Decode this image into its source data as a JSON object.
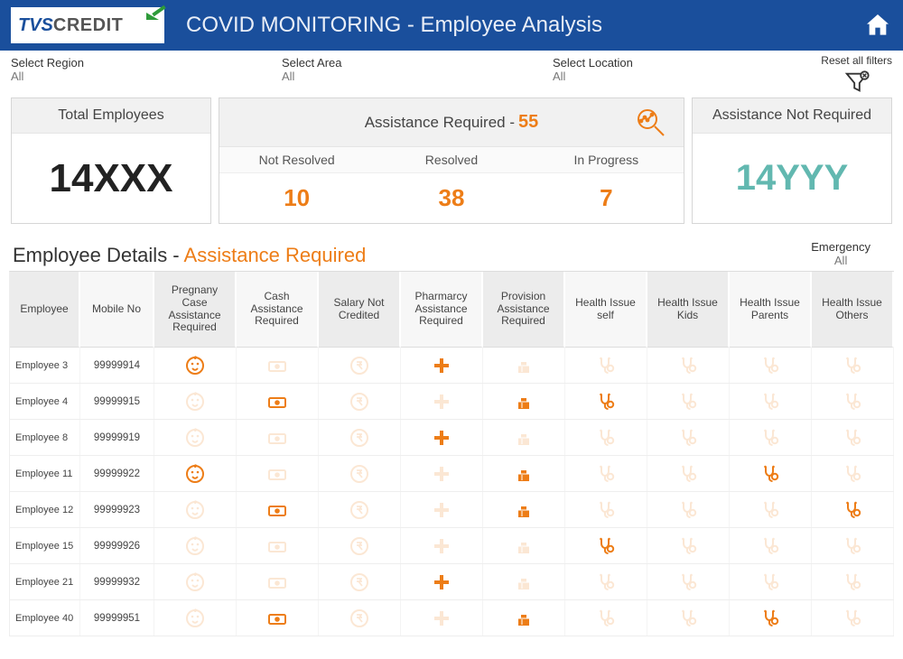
{
  "header": {
    "logo_text_1": "TVS",
    "logo_text_2": "CREDIT",
    "title": "COVID MONITORING - Employee Analysis"
  },
  "filters": {
    "region": {
      "label": "Select Region",
      "value": "All"
    },
    "area": {
      "label": "Select Area",
      "value": "All"
    },
    "location": {
      "label": "Select Location",
      "value": "All"
    },
    "reset_label": "Reset all filters"
  },
  "cards": {
    "total": {
      "title": "Total Employees",
      "value": "14XXX"
    },
    "assist": {
      "title": "Assistance Required -",
      "count": "55",
      "cols": [
        {
          "label": "Not Resolved",
          "value": "10"
        },
        {
          "label": "Resolved",
          "value": "38"
        },
        {
          "label": "In Progress",
          "value": "7"
        }
      ]
    },
    "notreq": {
      "title": "Assistance Not Required",
      "value": "14YYY"
    }
  },
  "details": {
    "title_a": "Employee Details - ",
    "title_b": "Assistance Required",
    "emergency": {
      "label": "Emergency",
      "value": "All"
    }
  },
  "table": {
    "headers": [
      "Employee",
      "Mobile No",
      "Pregnany Case Assistance Required",
      "Cash Assistance Required",
      "Salary Not Credited",
      "Pharmarcy Assistance Required",
      "Provision Assistance Required",
      "Health Issue self",
      "Health Issue Kids",
      "Health Issue Parents",
      "Health Issue Others"
    ],
    "rows": [
      {
        "emp": "Employee 3",
        "mobile": "99999914",
        "flags": [
          1,
          0,
          0,
          1,
          0,
          0,
          0,
          0,
          0
        ]
      },
      {
        "emp": "Employee 4",
        "mobile": "99999915",
        "flags": [
          0,
          1,
          0,
          0,
          1,
          1,
          0,
          0,
          0
        ]
      },
      {
        "emp": "Employee 8",
        "mobile": "99999919",
        "flags": [
          0,
          0,
          0,
          1,
          0,
          0,
          0,
          0,
          0
        ]
      },
      {
        "emp": "Employee 11",
        "mobile": "99999922",
        "flags": [
          1,
          0,
          0,
          0,
          1,
          0,
          0,
          1,
          0
        ]
      },
      {
        "emp": "Employee 12",
        "mobile": "99999923",
        "flags": [
          0,
          1,
          0,
          0,
          1,
          0,
          0,
          0,
          1
        ]
      },
      {
        "emp": "Employee 15",
        "mobile": "99999926",
        "flags": [
          0,
          0,
          0,
          0,
          0,
          1,
          0,
          0,
          0
        ]
      },
      {
        "emp": "Employee 21",
        "mobile": "99999932",
        "flags": [
          0,
          0,
          0,
          1,
          0,
          0,
          0,
          0,
          0
        ]
      },
      {
        "emp": "Employee 40",
        "mobile": "99999951",
        "flags": [
          0,
          1,
          0,
          0,
          1,
          0,
          0,
          1,
          0
        ]
      }
    ]
  },
  "colors": {
    "brand_blue": "#1a4f9c",
    "accent_orange": "#ed7d17",
    "teal": "#62b8b0",
    "dim_icon": "#f0d9c7"
  }
}
